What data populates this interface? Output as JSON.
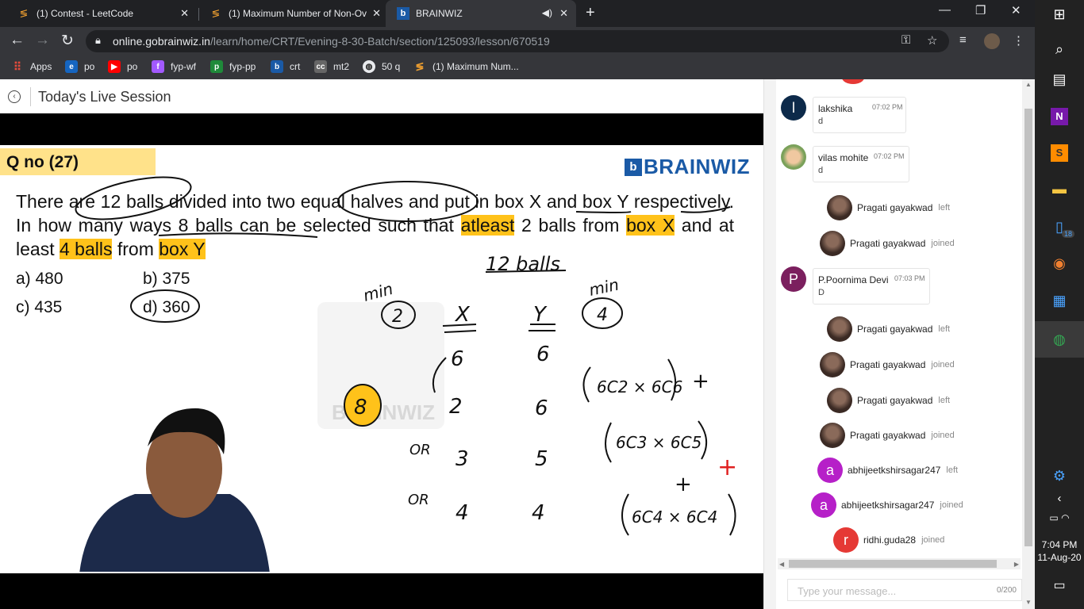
{
  "tabs": [
    {
      "title": "(1) Contest - LeetCode",
      "active": false
    },
    {
      "title": "(1) Maximum Number of Non-Ov",
      "active": false
    },
    {
      "title": "BRAINWIZ",
      "active": true
    }
  ],
  "address": {
    "domain": "online.gobrainwiz.in",
    "path": "/learn/home/CRT/Evening-8-30-Batch/section/125093/lesson/670519"
  },
  "bookmarks": [
    {
      "label": "Apps",
      "color": "#4a4a4a"
    },
    {
      "label": "po",
      "color": "#1565c0"
    },
    {
      "label": "po",
      "color": "#ff0000"
    },
    {
      "label": "fyp-wf",
      "color": "#a259ff"
    },
    {
      "label": "fyp-pp",
      "color": "#1f8a3a"
    },
    {
      "label": "crt",
      "color": "#1a5aa6"
    },
    {
      "label": "mt2",
      "color": "#666666"
    },
    {
      "label": "50 q",
      "color": "#5f6368"
    },
    {
      "label": "(1) Maximum Num...",
      "color": "#3c3c3c"
    }
  ],
  "session": {
    "title": "Today's Live Session"
  },
  "slide": {
    "qno": "Q no (27)",
    "brand": "BRAINWIZ",
    "q1": "There are 12 balls divided into two equal halves and put in box X and box Y respectively. In how many ways 8 balls can be selected such that ",
    "q_hl1": "atleast",
    "q2": " 2 balls from ",
    "q_hl2": "box X",
    "q3": " and at least ",
    "q_hl3": "4 balls",
    "q4": " from ",
    "q_hl4": "box Y",
    "options": [
      "a) 480",
      "b) 375",
      "c) 435",
      "d) 360"
    ],
    "watermark": "BRAINWIZ"
  },
  "handwriting": {
    "total": "12 balls",
    "min1": "min",
    "min2": "min",
    "minx": "2",
    "miny": "4",
    "hx": "X",
    "hy": "Y",
    "rows": [
      [
        "6",
        "6"
      ],
      [
        "2",
        "6"
      ],
      [
        "3",
        "5"
      ],
      [
        "4",
        "4"
      ]
    ],
    "or": "OR",
    "eight": "8",
    "plus": "+",
    "c1": "6C2 × 6C6",
    "c2": "6C3 × 6C5",
    "c3": "6C4 × 6C4"
  },
  "chat": {
    "messages": [
      {
        "type": "message",
        "initial": "l",
        "name": "lakshika",
        "time": "07:02 PM",
        "body": "d",
        "color": "#0d2a4a"
      },
      {
        "type": "message",
        "initial": "",
        "name": "vilas mohite",
        "time": "07:02 PM",
        "body": "d",
        "color": "photo"
      },
      {
        "type": "event",
        "name": "Pragati gayakwad",
        "action": "left"
      },
      {
        "type": "event",
        "name": "Pragati gayakwad",
        "action": "joined"
      },
      {
        "type": "message",
        "initial": "P",
        "name": "P.Poornima Devi",
        "time": "07:03 PM",
        "body": "D",
        "color": "#7b1f5e"
      },
      {
        "type": "event",
        "name": "Pragati gayakwad",
        "action": "left"
      },
      {
        "type": "event",
        "name": "Pragati gayakwad",
        "action": "joined"
      },
      {
        "type": "event",
        "name": "Pragati gayakwad",
        "action": "left"
      },
      {
        "type": "event",
        "name": "Pragati gayakwad",
        "action": "joined"
      },
      {
        "type": "event",
        "name": "abhijeetkshirsagar247",
        "action": "left",
        "initial": "a",
        "color": "#b620c8"
      },
      {
        "type": "event",
        "name": "abhijeetkshirsagar247",
        "action": "joined",
        "initial": "a",
        "color": "#b620c8"
      },
      {
        "type": "event",
        "name": "ridhi.guda28",
        "action": "joined",
        "initial": "r",
        "color": "#e53935"
      }
    ],
    "input_placeholder": "Type your message...",
    "char_count": "0/200"
  },
  "taskbar": {
    "time": "7:04 PM",
    "date": "11-Aug-20",
    "badge": "18"
  },
  "colors": {
    "highlight": "#ffc21a",
    "brand": "#1a5aa6",
    "annotation_red": "#e02020"
  }
}
